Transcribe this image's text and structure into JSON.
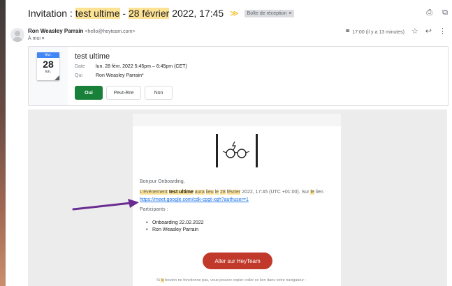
{
  "subject": {
    "prefix": "Invitation : ",
    "hl1": "test ultime",
    "sep": " - ",
    "hl2": "28 février",
    "rest": " 2022, 17:45",
    "label": "Boîte de réception",
    "label_close": "×"
  },
  "toolbar": {
    "print_icon": "⎙",
    "open_icon": "⧉"
  },
  "sender": {
    "name": "Ron Weasley Parrain",
    "email": "<hello@heyteam.com>",
    "to": "À moi ▾",
    "time": "17:00 (il y a 13 minutes)",
    "star": "☆",
    "reply": "↩",
    "more": "⋮",
    "tracker_icon": "⚭"
  },
  "invite": {
    "month": "févr.",
    "day": "28",
    "weekday": "lun.",
    "title": "test ultime",
    "date_label": "Date",
    "date_value": "lun. 28 févr. 2022 5:45pm – 6:45pm (CET)",
    "who_label": "Qui",
    "who_value": "Ron Weasley Parrain*",
    "yes": "Oui",
    "maybe": "Peut-être",
    "no": "Non"
  },
  "mail": {
    "greeting": "Bonjour Onboarding,",
    "line_w1": "L'événement",
    "line_bold": "test ultime",
    "line_w2": "aura",
    "line_w3": "lieu",
    "line_w4": "le",
    "line_w5": "28",
    "line_w6": "février",
    "line_rest": "2022, 17:45 (UTC +01:00). Sur",
    "line_w7": "le",
    "line_end": "lien",
    "link": "https://meet.google.com/cdk-cpgt-xqh?authuser=1",
    "participants_label": "Participants :",
    "participants": [
      "Onboarding 22.02.2022",
      "Ron Weasley Parrain"
    ],
    "cta": "Aller sur HeyTeam",
    "footer_pre": "Si",
    "footer_hl": "le",
    "footer_post": "bouton ne fonctionne pas, vous pouvez copier coller ce lien dans votre navigateur :"
  },
  "colors": {
    "highlight": "#fde293",
    "accept": "#188038",
    "cta": "#c0392b",
    "link": "#1a73e8",
    "arrow": "#6a2c91"
  }
}
